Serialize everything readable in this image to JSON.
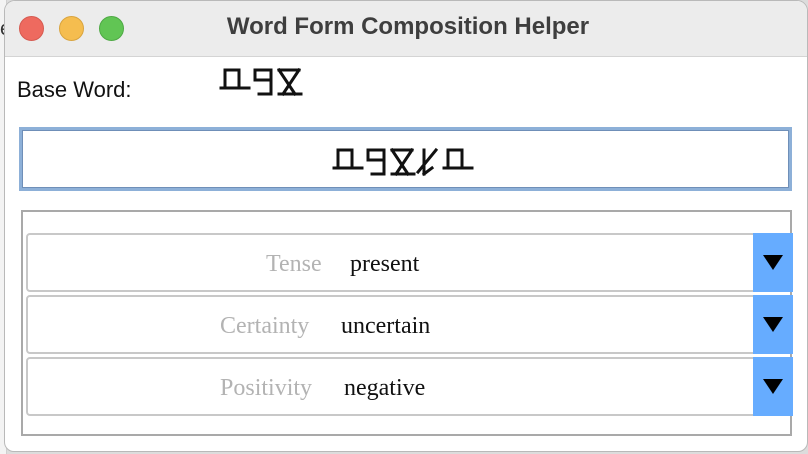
{
  "window": {
    "title": "Word Form Composition Helper"
  },
  "base_word": {
    "label": "Base Word:",
    "glyphs_icon": "conlang-script-base-word"
  },
  "result": {
    "glyphs_icon": "conlang-script-composed-word"
  },
  "selectors": [
    {
      "label": "Tense",
      "value": "present"
    },
    {
      "label": "Certainty",
      "value": "uncertain"
    },
    {
      "label": "Positivity",
      "value": "negative"
    }
  ],
  "colors": {
    "dropdown_accent": "#66acff",
    "focus_border": "#8db0d8"
  }
}
